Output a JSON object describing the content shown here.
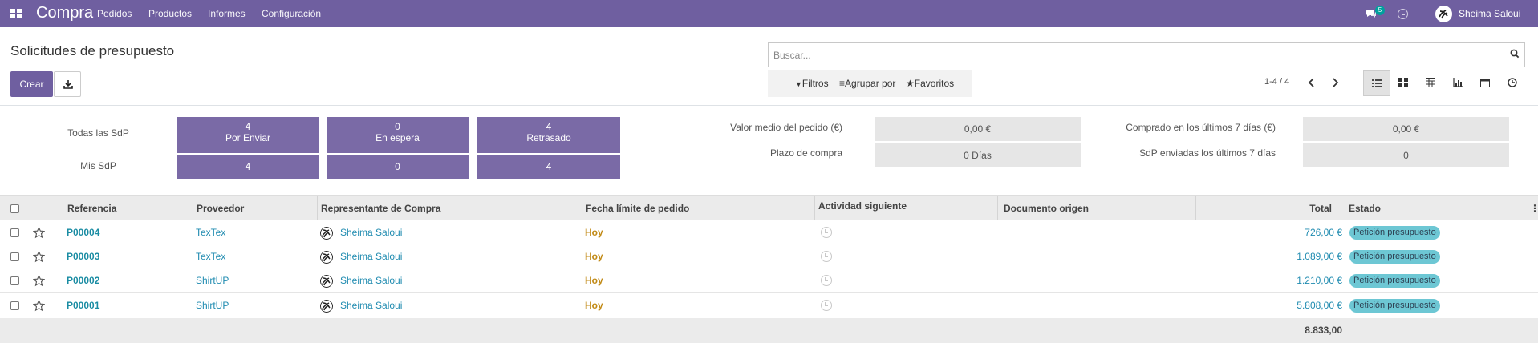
{
  "navbar": {
    "app_title": "Compra",
    "menu": [
      "Pedidos",
      "Productos",
      "Informes",
      "Configuración"
    ],
    "chat_count": "5",
    "user_name": "Sheima Saloui",
    "bg_color": "#6f5fa0"
  },
  "control_panel": {
    "title": "Solicitudes de presupuesto",
    "create_label": "Crear",
    "search_placeholder": "Buscar...",
    "filters_label": "Filtros",
    "group_by_label": "Agrupar por",
    "favorites_label": "Favoritos",
    "pager": "1-4 / 4",
    "views": [
      "list-view-icon",
      "kanban-view-icon",
      "pivot-view-icon",
      "graph-view-icon",
      "calendar-view-icon",
      "activity-view-icon"
    ],
    "active_view": "list-view-icon"
  },
  "dashboard": {
    "all_rfqs_label": "Todas las SdP",
    "my_rfqs_label": "Mis SdP",
    "cards": [
      {
        "all_value": "4",
        "label": "Por Enviar",
        "mine_value": "4"
      },
      {
        "all_value": "0",
        "label": "En espera",
        "mine_value": "0"
      },
      {
        "all_value": "4",
        "label": "Retrasado",
        "mine_value": "4"
      }
    ],
    "stats_left": [
      {
        "label": "Valor medio del pedido (€)",
        "value": "0,00 €"
      },
      {
        "label": "Plazo de compra",
        "value": "0  Días"
      }
    ],
    "stats_right": [
      {
        "label": "Comprado en los últimos 7 días (€)",
        "value": "0,00 €"
      },
      {
        "label": "SdP enviadas los últimos 7 días",
        "value": "0"
      }
    ],
    "card_color": "#7a6aa6"
  },
  "table": {
    "columns": {
      "reference": "Referencia",
      "vendor": "Proveedor",
      "buyer": "Representante de Compra",
      "order_deadline": "Fecha límite de pedido",
      "next_activity": "Actividad siguiente",
      "source_document": "Documento origen",
      "total": "Total",
      "status": "Estado"
    },
    "rows": [
      {
        "reference": "P00004",
        "vendor": "TexTex",
        "buyer": "Sheima Saloui",
        "deadline": "Hoy",
        "total": "726,00 €",
        "status": "Petición presupuesto"
      },
      {
        "reference": "P00003",
        "vendor": "TexTex",
        "buyer": "Sheima Saloui",
        "deadline": "Hoy",
        "total": "1.089,00 €",
        "status": "Petición presupuesto"
      },
      {
        "reference": "P00002",
        "vendor": "ShirtUP",
        "buyer": "Sheima Saloui",
        "deadline": "Hoy",
        "total": "1.210,00 €",
        "status": "Petición presupuesto"
      },
      {
        "reference": "P00001",
        "vendor": "ShirtUP",
        "buyer": "Sheima Saloui",
        "deadline": "Hoy",
        "total": "5.808,00 €",
        "status": "Petición presupuesto"
      }
    ],
    "grand_total": "8.833,00"
  }
}
